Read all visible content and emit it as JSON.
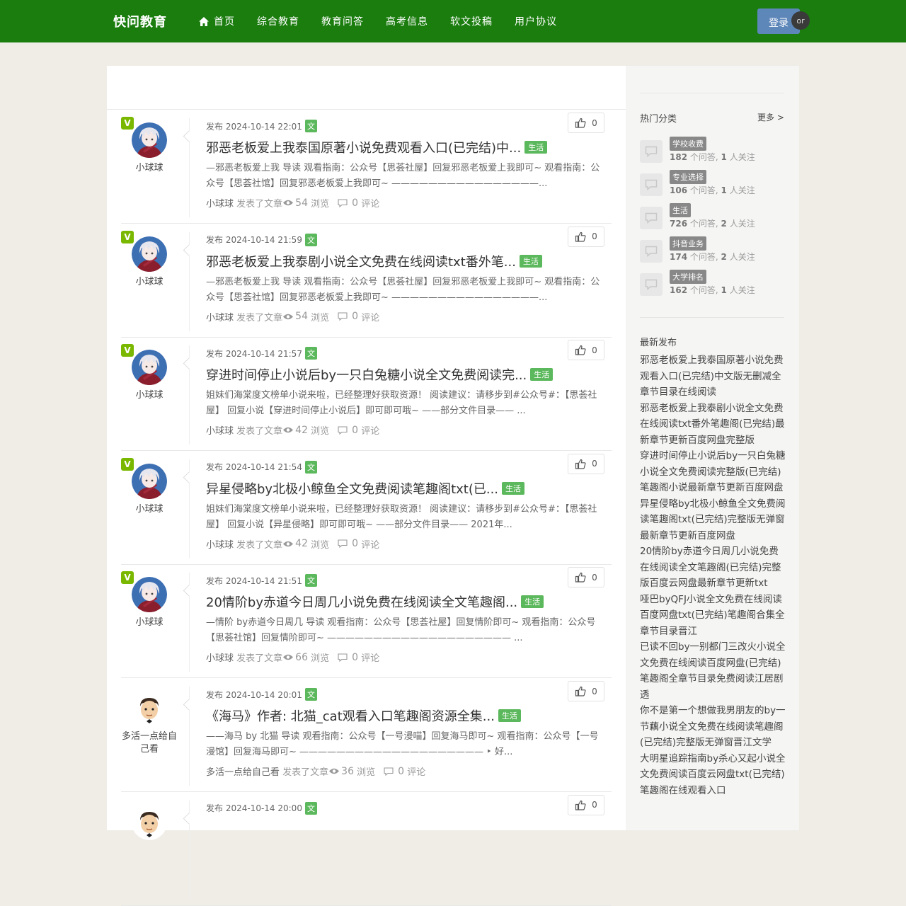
{
  "header": {
    "logo": "快问教育",
    "nav": [
      "首页",
      "综合教育",
      "教育问答",
      "高考信息",
      "软文投稿",
      "用户协议"
    ],
    "login": "登录",
    "or": "or"
  },
  "colors": {
    "header_bg": "#1a7d0e",
    "tag_green": "#5cb85c",
    "v_badge": "#7ab800",
    "login_bg": "#5d86b9"
  },
  "items": [
    {
      "author": "小球球",
      "verified": true,
      "avatar": "anime-avatar",
      "date": "发布 2024-10-14 22:01",
      "tag": "文",
      "likes": "0",
      "title": "邪恶老板爱上我泰国原著小说免费观看入口(已完结)中...",
      "cat": "生活",
      "excerpt": "—邪恶老板爱上我 导读 观看指南：公众号【思荟社屋】回复邪恶老板爱上我即可~ 观看指南：公众号【思荟社馆】回复邪恶老板爱上我即可~ ————————————————...",
      "action": "发表了文章",
      "views": "54",
      "views_label": "浏览",
      "comments": "0",
      "comments_label": "评论"
    },
    {
      "author": "小球球",
      "verified": true,
      "avatar": "anime-avatar",
      "date": "发布 2024-10-14 21:59",
      "tag": "文",
      "likes": "0",
      "title": "邪恶老板爱上我泰剧小说全文免费在线阅读txt番外笔...",
      "cat": "生活",
      "excerpt": "—邪恶老板爱上我 导读 观看指南：公众号【思荟社屋】回复邪恶老板爱上我即可~ 观看指南：公众号【思荟社馆】回复邪恶老板爱上我即可~ ————————————————...",
      "action": "发表了文章",
      "views": "54",
      "views_label": "浏览",
      "comments": "0",
      "comments_label": "评论"
    },
    {
      "author": "小球球",
      "verified": true,
      "avatar": "anime-avatar",
      "date": "发布 2024-10-14 21:57",
      "tag": "文",
      "likes": "0",
      "title": "穿进时间停止小说后by一只白兔糖小说全文免费阅读完...",
      "cat": "生活",
      "excerpt": "姐妹们海棠度文榜单小说来啦，已经整理好获取资源！ 阅读建议：请移步到#公众号#：【思荟社屋】 回复小说【穿进时间停止小说后】即可即可哦~ ——部分文件目录—— ...",
      "action": "发表了文章",
      "views": "42",
      "views_label": "浏览",
      "comments": "0",
      "comments_label": "评论"
    },
    {
      "author": "小球球",
      "verified": true,
      "avatar": "anime-avatar",
      "date": "发布 2024-10-14 21:54",
      "tag": "文",
      "likes": "0",
      "title": "异星侵略by北极小鲸鱼全文免费阅读笔趣阁txt(已...",
      "cat": "生活",
      "excerpt": "姐妹们海棠度文榜单小说来啦，已经整理好获取资源！ 阅读建议：请移步到#公众号#：【思荟社屋】 回复小说【异星侵略】即可即可哦~ ——部分文件目录—— 2021年...",
      "action": "发表了文章",
      "views": "42",
      "views_label": "浏览",
      "comments": "0",
      "comments_label": "评论"
    },
    {
      "author": "小球球",
      "verified": true,
      "avatar": "anime-avatar",
      "date": "发布 2024-10-14 21:51",
      "tag": "文",
      "likes": "0",
      "title": "20情阶by赤道今日周几小说免费在线阅读全文笔趣阁...",
      "cat": "生活",
      "excerpt": "—情阶 by赤道今日周几 导读 观看指南：公众号【思荟社屋】回复情阶即可~ 观看指南：公众号【思荟社馆】回复情阶即可~ ———————————————————— ...",
      "action": "发表了文章",
      "views": "66",
      "views_label": "浏览",
      "comments": "0",
      "comments_label": "评论"
    },
    {
      "author": "多活一点给自己看",
      "verified": false,
      "avatar": "cartoon-avatar",
      "date": "发布 2024-10-14 20:01",
      "tag": "文",
      "likes": "0",
      "title": "《海马》作者: 北猫_cat观看入口笔趣阁资源全集...",
      "cat": "生活",
      "excerpt": "——海马 by 北猫 导读 观看指南：公众号【一号漫喵】回复海马即可~ 观看指南：公众号【一号漫馆】回复海马即可~ ———————————————————— ‣ 好...",
      "action": "发表了文章",
      "views": "36",
      "views_label": "浏览",
      "comments": "0",
      "comments_label": "评论"
    },
    {
      "author": "",
      "verified": false,
      "avatar": "cartoon-avatar",
      "date": "发布 2024-10-14 20:00",
      "tag": "文",
      "likes": "0",
      "title": "",
      "cat": "",
      "excerpt": "",
      "action": "",
      "views": "",
      "views_label": "",
      "comments": "",
      "comments_label": ""
    }
  ],
  "sidebar": {
    "hot_title": "热门分类",
    "more": "更多 >",
    "categories": [
      {
        "name": "学校收费",
        "questions": "182",
        "q_label": "个问答,",
        "followers": "1",
        "f_label": "人关注"
      },
      {
        "name": "专业选择",
        "questions": "106",
        "q_label": "个问答,",
        "followers": "1",
        "f_label": "人关注"
      },
      {
        "name": "生活",
        "questions": "726",
        "q_label": "个问答,",
        "followers": "2",
        "f_label": "人关注"
      },
      {
        "name": "抖音业务",
        "questions": "174",
        "q_label": "个问答,",
        "followers": "2",
        "f_label": "人关注"
      },
      {
        "name": "大学排名",
        "questions": "162",
        "q_label": "个问答,",
        "followers": "1",
        "f_label": "人关注"
      }
    ],
    "latest_title": "最新发布",
    "latest": [
      "邪恶老板爱上我泰国原著小说免费观看入口(已完结)中文版无删减全章节目录在线阅读",
      "邪恶老板爱上我泰剧小说全文免费在线阅读txt番外笔趣阁(已完结)最新章节更新百度网盘完整版",
      "穿进时间停止小说后by一只白兔糖小说全文免费阅读完整版(已完结)笔趣阁小说最新章节更新百度网盘",
      "异星侵略by北极小鲸鱼全文免费阅读笔趣阁txt(已完结)完整版无弹窗最新章节更新百度网盘",
      "20情阶by赤道今日周几小说免费在线阅读全文笔趣阁(已完结)完整版百度云网盘最新章节更新txt",
      "哑巴byQFJ小说全文免费在线阅读百度网盘txt(已完结)笔趣阁合集全章节目录晋江",
      "已读不回by一别都门三改火小说全文免费在线阅读百度网盘(已完结)笔趣阁全章节目录免费阅读江居剧透",
      "你不是第一个想做我男朋友的by一节藕小说全文免费在线阅读笔趣阁(已完结)完整版无弹窗晋江文学",
      "大明星追踪指南by杀心又起小说全文免费阅读百度云网盘txt(已完结)笔趣阁在线观看入口"
    ]
  }
}
